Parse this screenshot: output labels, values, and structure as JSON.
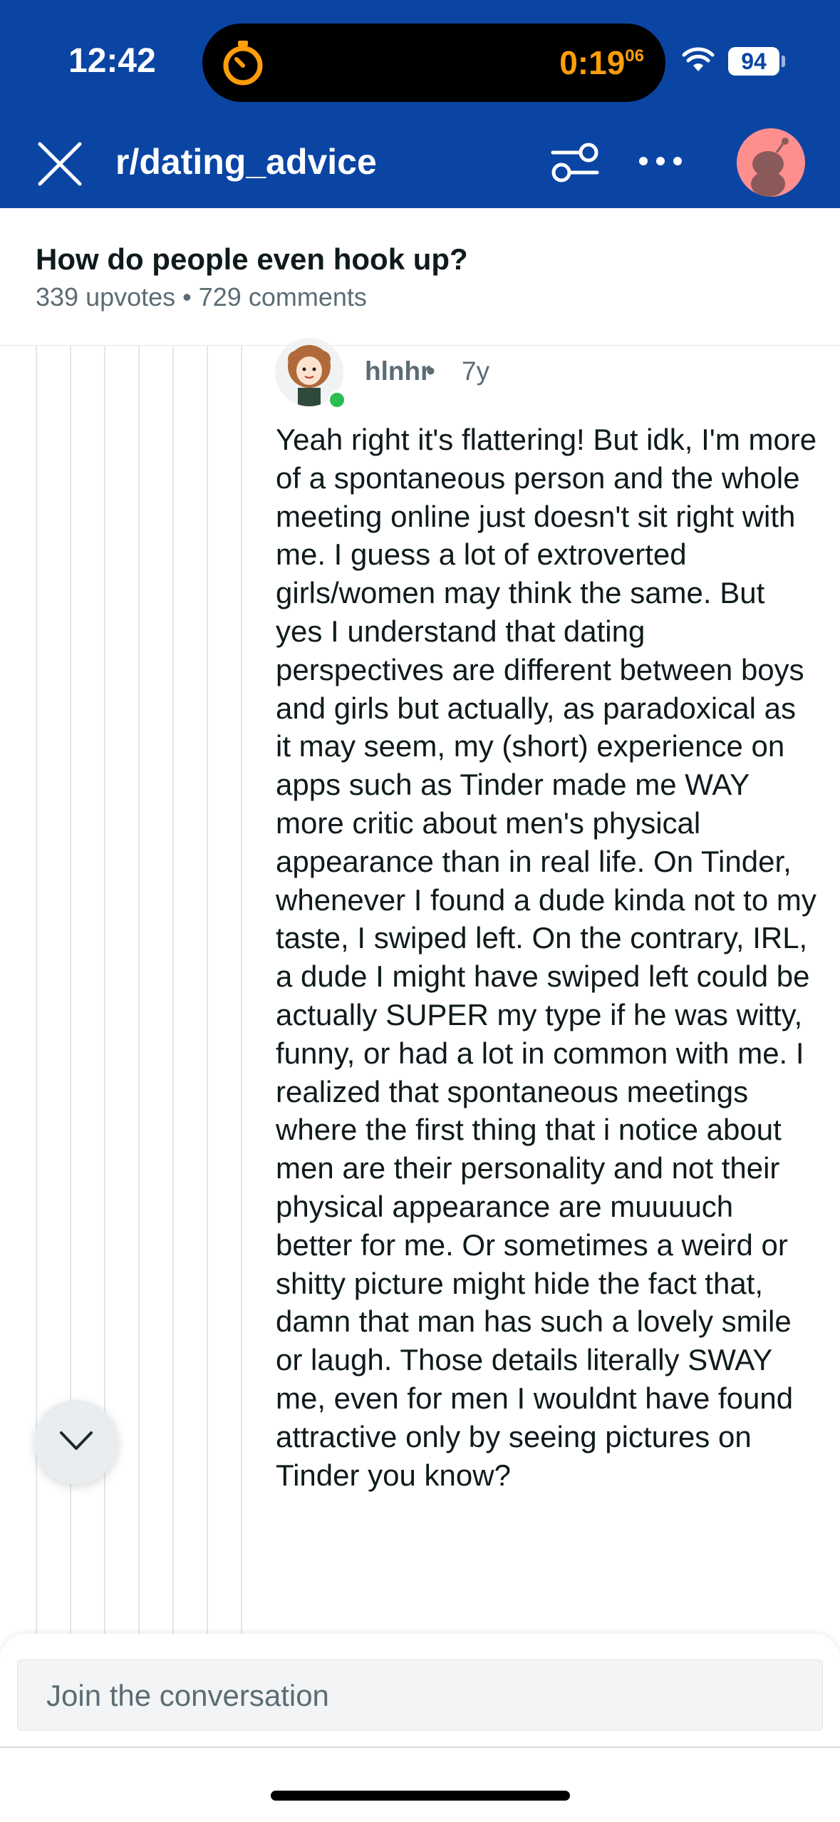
{
  "status_bar": {
    "time": "12:42",
    "timer": "0:19",
    "timer_fraction": "06",
    "battery": "94"
  },
  "nav": {
    "subreddit": "r/dating_advice"
  },
  "post": {
    "title": "How do people even hook up?",
    "meta": "339 upvotes • 729 comments"
  },
  "comment": {
    "author": "hlnhr",
    "separator": "•",
    "age": "7y",
    "body": "Yeah right it's flattering! But idk, I'm more of a spontaneous person and the whole meeting online just doesn't sit right with me. I guess a lot of extroverted girls/women may think the same. But yes I understand that dating perspectives are different between boys and girls but actually, as paradoxical as it may seem, my (short) experience on apps such as Tinder made me WAY more critic about men's physical appearance than in real life. On Tinder, whenever I found a dude kinda not to my taste, I swiped left. On the contrary, IRL, a dude I might have swiped left could be actually SUPER my type if he was witty, funny, or had a lot in common with me. I realized that spontaneous meetings where the first thing that i notice about men are their personality and not their physical appearance are muuuuch better for me. Or sometimes a weird or shitty picture might hide the fact that, damn that man has such a lovely smile or laugh. Those details literally SWAY me, even for men I wouldnt have found attractive only by seeing pictures on Tinder you know?"
  },
  "composer": {
    "placeholder": "Join the conversation"
  },
  "colors": {
    "header_blue": "#0b45a4",
    "timer_orange": "#ff9d0a",
    "online_green": "#2bbd52",
    "meta_gray": "#5c6c74"
  },
  "icons": [
    "timer-icon",
    "wifi-icon",
    "close-icon",
    "filter-icon",
    "more-icon",
    "avatar",
    "chevron-down-icon"
  ]
}
